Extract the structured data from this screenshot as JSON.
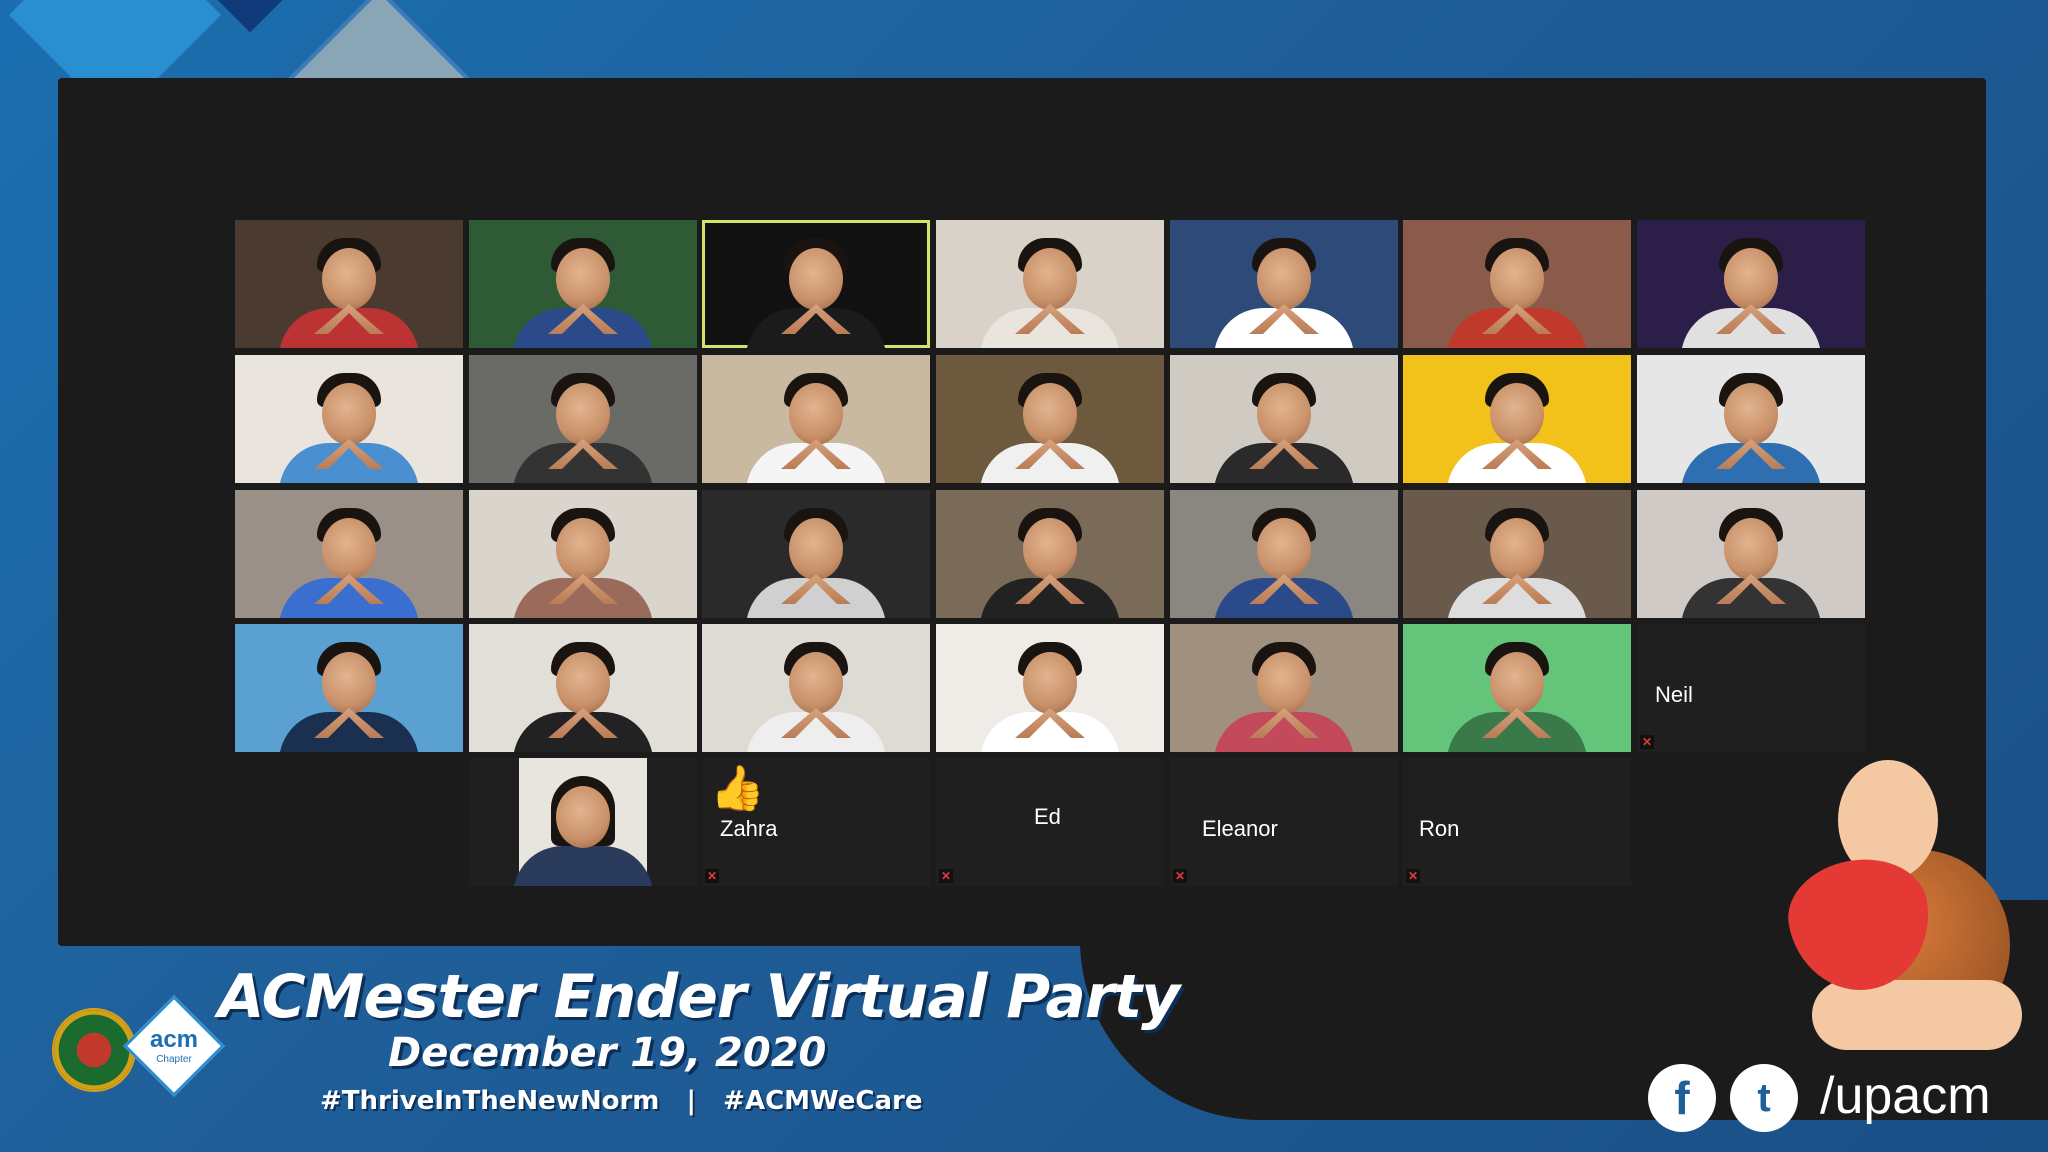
{
  "banner": {
    "title": "ACMester Ender Virtual Party",
    "date": "December 19, 2020",
    "hashtags": "#ThriveInTheNewNorm   |   #ACMWeCare"
  },
  "logos": {
    "acm": "acm",
    "acm_sub": "Chapter"
  },
  "social": {
    "facebook": "f",
    "twitter": "t",
    "handle": "/upacm"
  },
  "participants": {
    "neil": "Neil",
    "zahra": "Zahra",
    "ed": "Ed",
    "eleanor": "Eleanor",
    "ron": "Ron"
  },
  "colors": {
    "background": "#1f5f9a",
    "zoom_frame": "#1b1b1b",
    "active_speaker": "#d6e36a",
    "mic_muted": "#e03a3a"
  }
}
